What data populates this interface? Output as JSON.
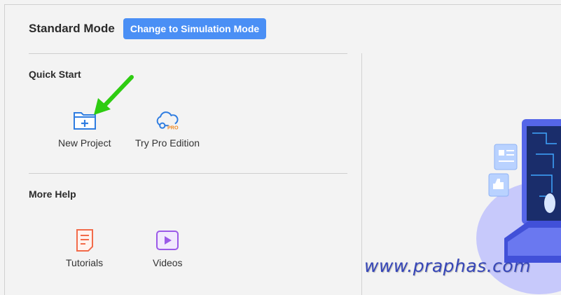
{
  "header": {
    "mode_title": "Standard Mode",
    "switch_mode_label": "Change to Simulation Mode"
  },
  "quick_start": {
    "title": "Quick Start",
    "items": [
      {
        "label": "New Project",
        "icon": "folder-plus-icon"
      },
      {
        "label": "Try Pro Edition",
        "icon": "cloud-pro-icon"
      }
    ]
  },
  "more_help": {
    "title": "More Help",
    "items": [
      {
        "label": "Tutorials",
        "icon": "document-icon"
      },
      {
        "label": "Videos",
        "icon": "play-icon"
      }
    ]
  },
  "pro_badge": "PRO",
  "watermark": "www.praphas.com",
  "colors": {
    "accent": "#4a8ff5",
    "arrow": "#2ecc11",
    "tutorial_icon": "#f26b4a",
    "video_icon": "#9b59e8",
    "watermark": "#3646b8"
  }
}
